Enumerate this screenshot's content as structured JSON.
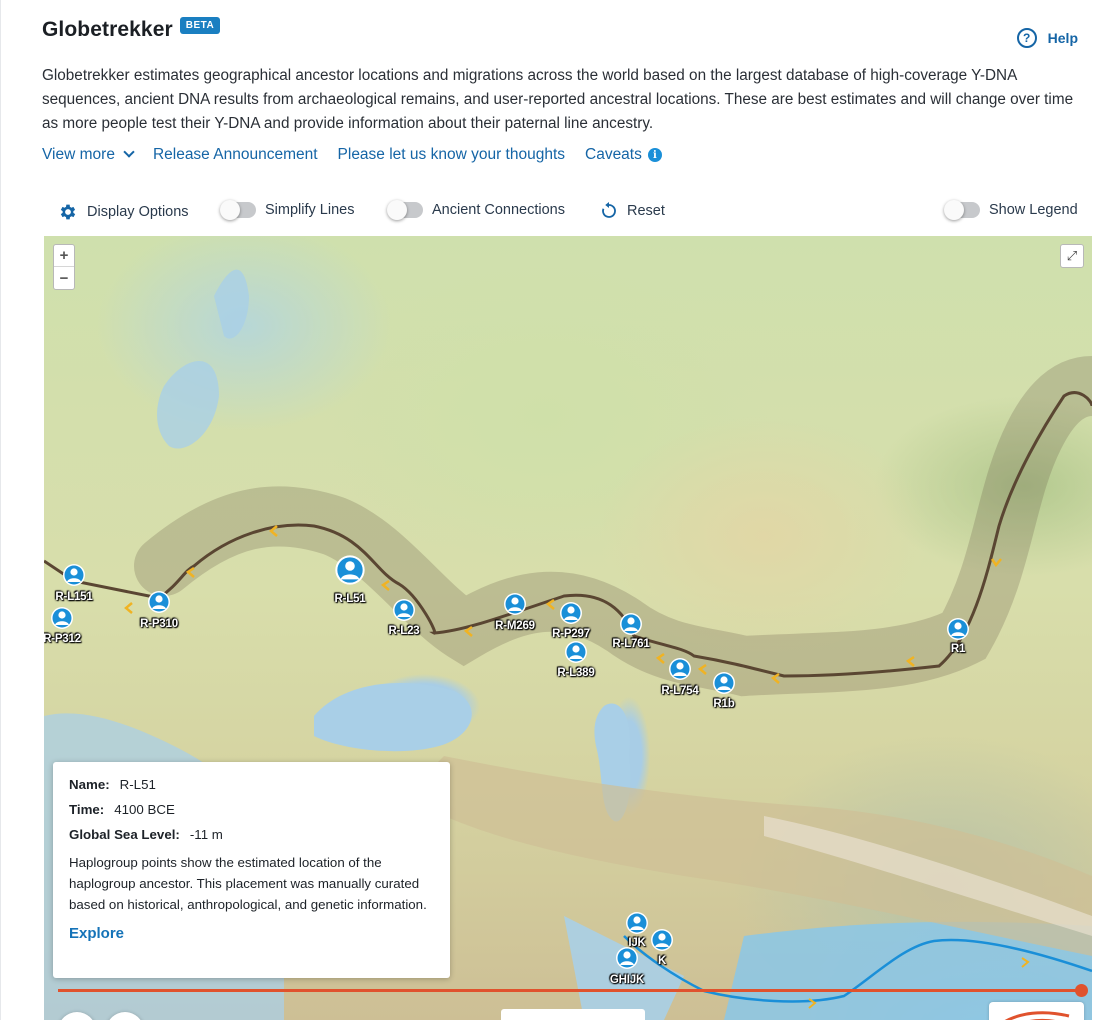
{
  "app": {
    "title": "Globetrekker",
    "badge": "BETA",
    "help_label": "Help",
    "description": "Globetrekker estimates geographical ancestor locations and migrations across the world based on the largest database of high-coverage Y-DNA sequences, ancient DNA results from archaeological remains, and user-reported ancestral locations. These are best estimates and will change over time as more people test their Y-DNA and provide information about their paternal line ancestry."
  },
  "links": {
    "view_more": "View more",
    "release": "Release Announcement",
    "feedback": "Please let us know your thoughts",
    "caveats": "Caveats"
  },
  "toolbar": {
    "display_options": "Display Options",
    "simplify_lines": "Simplify Lines",
    "ancient_connections": "Ancient Connections",
    "reset": "Reset",
    "show_legend": "Show Legend",
    "simplify_lines_on": false,
    "ancient_connections_on": false,
    "show_legend_on": false
  },
  "map": {
    "zoom_in": "+",
    "zoom_out": "−",
    "markers": [
      {
        "label": "R-L151"
      },
      {
        "label": "R-P312"
      },
      {
        "label": "R-P310"
      },
      {
        "label": "R-L51",
        "selected": true
      },
      {
        "label": "R-L23"
      },
      {
        "label": "R-M269"
      },
      {
        "label": "R-P297"
      },
      {
        "label": "R-L389"
      },
      {
        "label": "R-L761"
      },
      {
        "label": "R-L754"
      },
      {
        "label": "R1b"
      },
      {
        "label": "R1"
      },
      {
        "label": "IJK"
      },
      {
        "label": "K"
      },
      {
        "label": "GHIJK"
      }
    ]
  },
  "popup": {
    "name_label": "Name:",
    "name": "R-L51",
    "time_label": "Time:",
    "time": "4100 BCE",
    "sea_label": "Global Sea Level:",
    "sea": "-11 m",
    "description": "Haplogroup points show the estimated location of the haplogroup ancestor. This placement was manually curated based on historical, anthropological, and genetic information.",
    "explore": "Explore"
  },
  "timeline": {
    "progress": 1.0
  },
  "colors": {
    "accent": "#1565a6",
    "badge": "#1a7fc1",
    "path": "#5a4632",
    "arrow": "#f0b323",
    "timeline": "#e0522d",
    "marker": "#1a8fd8"
  }
}
